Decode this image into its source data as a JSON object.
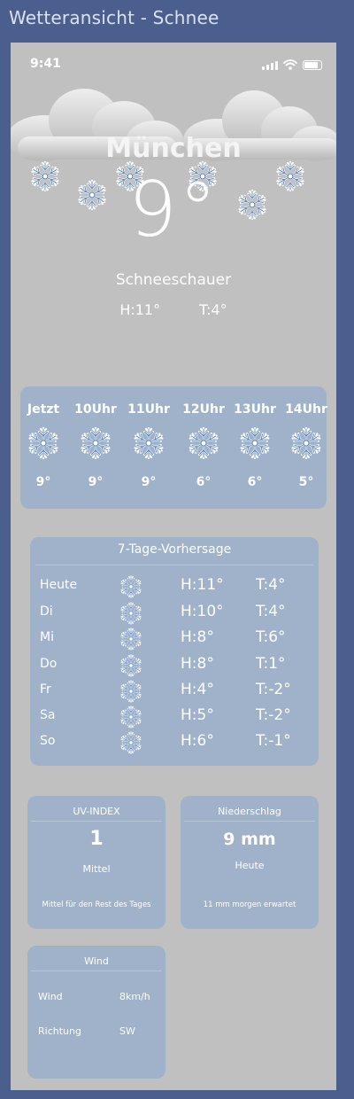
{
  "window": {
    "title": "Wetteransicht - Schnee"
  },
  "status": {
    "time": "9:41"
  },
  "current": {
    "city": "München",
    "temperature": "9°",
    "condition": "Schneeschauer",
    "high": "H:11°",
    "low": "T:4°"
  },
  "hourly": [
    {
      "label": "Jetzt",
      "temp": "9°",
      "icon": "snowflake-icon"
    },
    {
      "label": "10Uhr",
      "temp": "9°",
      "icon": "snowflake-icon"
    },
    {
      "label": "11Uhr",
      "temp": "9°",
      "icon": "snowflake-icon"
    },
    {
      "label": "12Uhr",
      "temp": "6°",
      "icon": "snowflake-icon"
    },
    {
      "label": "13Uhr",
      "temp": "6°",
      "icon": "snowflake-icon"
    },
    {
      "label": "14Uhr",
      "temp": "5°",
      "icon": "snowflake-icon"
    }
  ],
  "forecast": {
    "title": "7-Tage-Vorhersage",
    "days": [
      {
        "day": "Heute",
        "high": "H:11°",
        "low": "T:4°"
      },
      {
        "day": "Di",
        "high": "H:10°",
        "low": "T:4°"
      },
      {
        "day": "Mi",
        "high": "H:8°",
        "low": "T:6°"
      },
      {
        "day": "Do",
        "high": "H:8°",
        "low": "T:1°"
      },
      {
        "day": "Fr",
        "high": "H:4°",
        "low": "T:-2°"
      },
      {
        "day": "Sa",
        "high": "H:5°",
        "low": "T:-2°"
      },
      {
        "day": "So",
        "high": "H:6°",
        "low": "T:-1°"
      }
    ]
  },
  "uv": {
    "title": "UV-INDEX",
    "value": "1",
    "level": "Mittel",
    "note": "Mittel für den Rest des Tages"
  },
  "precipitation": {
    "title": "Niederschlag",
    "value": "9 mm",
    "when": "Heute",
    "note": "11 mm morgen erwartet"
  },
  "wind": {
    "title": "Wind",
    "speed_label": "Wind",
    "speed": "8km/h",
    "direction_label": "Richtung",
    "direction": "SW"
  },
  "colors": {
    "background": "#4b5f8f",
    "phone": "#c0c0c0",
    "card": "#9fb2c9"
  }
}
